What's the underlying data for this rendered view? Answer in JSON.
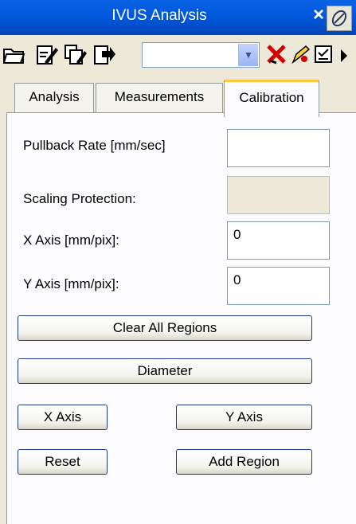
{
  "window": {
    "title": "IVUS Analysis",
    "close_glyph": "×"
  },
  "toolbar": {
    "icons": [
      "open-folder-icon",
      "signature-icon",
      "multi-sign-icon",
      "export-icon",
      "red-x-icon",
      "pencil-icon",
      "form-icon",
      "play-arrow-icon"
    ],
    "combo_value": ""
  },
  "tabs": [
    {
      "label": "Analysis",
      "active": false
    },
    {
      "label": "Measurements",
      "active": false
    },
    {
      "label": "Calibration",
      "active": true
    }
  ],
  "form": {
    "pullback_label": "Pullback Rate [mm/sec]",
    "pullback_value": "",
    "scaling_label": "Scaling Protection:",
    "scaling_value": "",
    "x_axis_label": "X Axis [mm/pix]:",
    "x_axis_value": "0",
    "y_axis_label": "Y Axis [mm/pix]:",
    "y_axis_value": "0"
  },
  "buttons": {
    "clear_all": "Clear All Regions",
    "diameter": "Diameter",
    "x_axis": "X Axis",
    "y_axis": "Y Axis",
    "reset": "Reset",
    "add_region": "Add Region"
  },
  "colors": {
    "title_bar": "#0056d8",
    "tab_highlight": "#ffc83c",
    "window_bg": "#ece9d8"
  }
}
